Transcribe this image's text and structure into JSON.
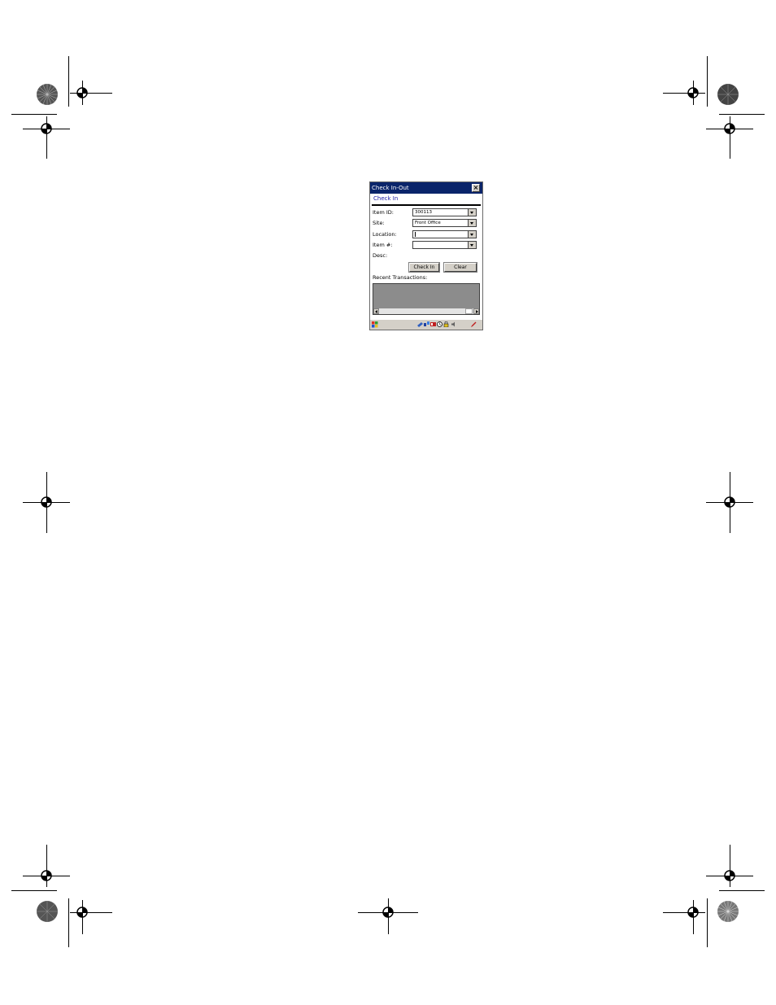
{
  "window": {
    "title": "Check In-Out",
    "close_glyph": "×"
  },
  "tab": {
    "label": "Check In"
  },
  "form": {
    "item_id_label": "Item ID:",
    "item_id_value": "300113",
    "site_label": "Site:",
    "site_value": "Front Office",
    "location_label": "Location:",
    "location_value": "",
    "item_num_label": "Item #:",
    "item_num_value": "",
    "desc_label": "Desc:"
  },
  "buttons": {
    "check_in": "Check In",
    "clear": "Clear"
  },
  "transactions": {
    "label": "Recent Transactions:"
  },
  "taskbar": {
    "start_icon": "windows-flag-icon",
    "tray_icons": [
      "network-icon",
      "connection-icon",
      "battery-icon",
      "clock-icon",
      "lock-icon",
      "speaker-icon",
      "pen-icon"
    ]
  },
  "colors": {
    "titlebar": "#0a246a",
    "tab_text": "#1a1aa6",
    "listbox": "#8c8c8c",
    "chrome": "#d4d0c8"
  }
}
